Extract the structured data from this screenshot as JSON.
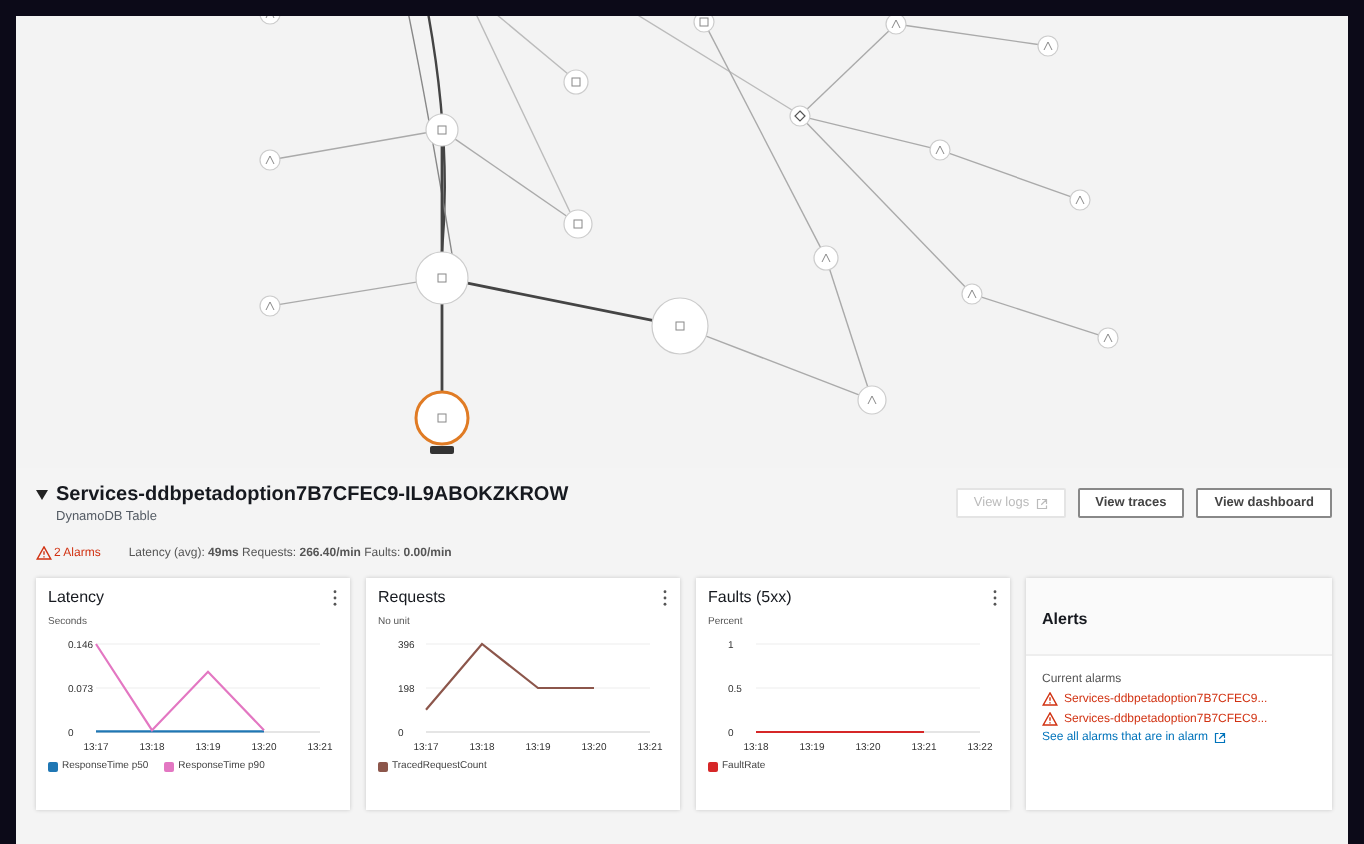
{
  "service_map": {
    "nodes": [
      {
        "selected": false
      },
      {
        "selected": false
      },
      {
        "selected": false
      },
      {
        "selected": false
      },
      {
        "selected": false
      },
      {
        "selected": false
      },
      {
        "selected": false
      },
      {
        "selected": true
      },
      {
        "selected": false
      },
      {
        "selected": false
      },
      {
        "selected": false
      },
      {
        "selected": false
      },
      {
        "selected": false
      },
      {
        "selected": false
      },
      {
        "selected": false
      },
      {
        "selected": false
      },
      {
        "selected": false
      },
      {
        "selected": false
      },
      {
        "selected": false
      }
    ]
  },
  "detail": {
    "title": "Services-ddbpetadoption7B7CFEC9-IL9ABOKZKROW",
    "expanded": true,
    "subtitle": "DynamoDB Table",
    "buttons": [
      {
        "label": "View logs",
        "disabled": true,
        "external": true
      },
      {
        "label": "View traces",
        "disabled": false,
        "external": false
      },
      {
        "label": "View dashboard",
        "disabled": false,
        "external": false
      }
    ],
    "alarms": "2 Alarms",
    "summary": "Latency (avg): **49ms** Requests: **266.40/min** Faults: **0.00/min**"
  },
  "cards": [
    {
      "title": "Latency",
      "chart_data": {
        "type": "line",
        "ylabel": "Seconds",
        "categories": [
          "13:17",
          "13:18",
          "13:19",
          "13:20",
          "13:21"
        ],
        "ylim": [
          0,
          0.146
        ],
        "yticks": [
          {
            "value": 0,
            "label": "0"
          },
          {
            "value": 0.073,
            "label": "0.073"
          },
          {
            "value": 0.146,
            "label": "0.146"
          }
        ],
        "series": [
          {
            "name": "ResponseTime p50",
            "color": "#1f77b4",
            "values": [
              0.001,
              0.001,
              0.001,
              0.001,
              null
            ]
          },
          {
            "name": "ResponseTime p90",
            "color": "#e377c2",
            "values": [
              0.146,
              0.003,
              0.1,
              0.003,
              null
            ]
          }
        ]
      }
    },
    {
      "title": "Requests",
      "chart_data": {
        "type": "line",
        "ylabel": "No unit",
        "categories": [
          "13:17",
          "13:18",
          "13:19",
          "13:20",
          "13:21"
        ],
        "ylim": [
          0,
          396
        ],
        "yticks": [
          {
            "value": 0,
            "label": "0"
          },
          {
            "value": 198,
            "label": "198"
          },
          {
            "value": 396,
            "label": "396"
          }
        ],
        "series": [
          {
            "name": "TracedRequestCount",
            "color": "#8c564b",
            "values": [
              100,
              396,
              198,
              198,
              null
            ]
          }
        ]
      }
    },
    {
      "title": "Faults (5xx)",
      "chart_data": {
        "type": "line",
        "ylabel": "Percent",
        "categories": [
          "13:18",
          "13:19",
          "13:20",
          "13:21",
          "13:22"
        ],
        "ylim": [
          0,
          1
        ],
        "yticks": [
          {
            "value": 0,
            "label": "0"
          },
          {
            "value": 0.5,
            "label": "0.5"
          },
          {
            "value": 1,
            "label": "1"
          }
        ],
        "series": [
          {
            "name": "FaultRate",
            "color": "#d62728",
            "values": [
              0,
              0,
              0,
              0,
              null
            ]
          }
        ]
      }
    }
  ],
  "alerts": {
    "title": "Alerts",
    "heading": "Current alarms",
    "items": [
      {
        "kind": "alarm",
        "text": "Services-ddbpetadoption7B7CFEC9..."
      },
      {
        "kind": "alarm",
        "text": "Services-ddbpetadoption7B7CFEC9..."
      },
      {
        "kind": "link",
        "text": "See all alarms that are in alarm"
      }
    ]
  }
}
